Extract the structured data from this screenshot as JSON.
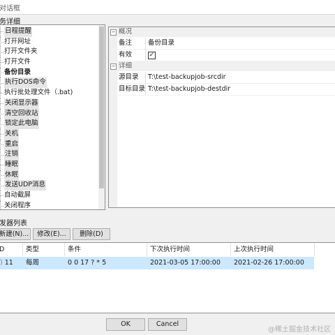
{
  "window": {
    "title": "对话框"
  },
  "task_details": {
    "label": "务详细",
    "tree_items": [
      {
        "label": "日程提醒",
        "highlight": true
      },
      {
        "label": "打开网址"
      },
      {
        "label": "打开文件夹"
      },
      {
        "label": "打开文件"
      },
      {
        "label": "备份目录",
        "bold": true
      },
      {
        "label": "执行DOS命令",
        "highlight": true
      },
      {
        "label": "执行批处理文件（.bat)"
      },
      {
        "label": "关闭显示器",
        "highlight": true
      },
      {
        "label": "清空回收站",
        "highlight": true
      },
      {
        "label": "锁定此电脑",
        "highlight": true
      },
      {
        "label": "关机",
        "highlight": true
      },
      {
        "label": "重启",
        "highlight": true
      },
      {
        "label": "注销",
        "highlight": true
      },
      {
        "label": "睡眠",
        "highlight": true
      },
      {
        "label": "休眠",
        "highlight": true
      },
      {
        "label": "发送UDP消息",
        "highlight": true
      },
      {
        "label": "自动截屏"
      },
      {
        "label": "关闭程序"
      }
    ]
  },
  "property_grid": {
    "category_overview": "概况",
    "note_label": "备注",
    "note_value": "备份目录",
    "enabled_label": "有效",
    "enabled_checked": true,
    "enabled_check_glyph": "✓",
    "category_detail": "详细",
    "source_label": "源目录",
    "source_value": "T:\\test-backupjob-srcdir",
    "target_label": "目标目录",
    "target_value": "T:\\test-backupjob-destdir",
    "collapse_glyph": "−"
  },
  "triggers": {
    "label": "发器列表",
    "buttons": {
      "new": "新建(N)...",
      "edit": "修改(E)...",
      "delete": "删除(D)"
    },
    "columns": [
      "D",
      "类型",
      "条件",
      "下次执行时间",
      "上次执行时间"
    ],
    "rows": [
      {
        "id": "11",
        "type": "每周",
        "condition": "0 0 17 ? * 5",
        "next_run": "2021-03-05 17:00:00",
        "last_run": "2021-02-26 17:00:00"
      }
    ]
  },
  "footer": {
    "ok": "OK",
    "cancel": "Cancel"
  },
  "watermark": "@稀土掘金技术社区"
}
